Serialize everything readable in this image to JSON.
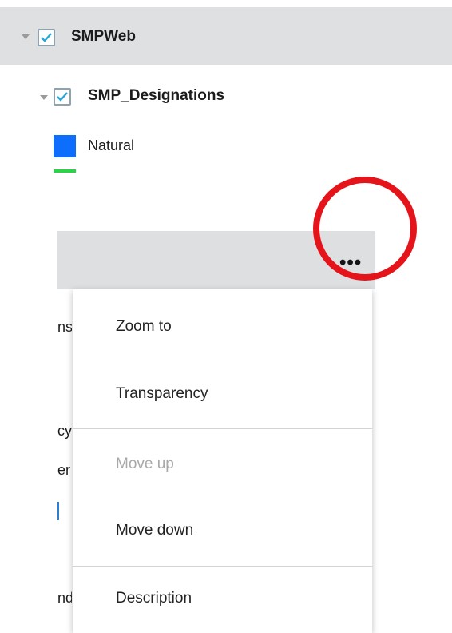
{
  "tree": {
    "root": {
      "label": "SMPWeb",
      "checked": true,
      "expanded": true
    },
    "child": {
      "label": "SMP_Designations",
      "checked": true,
      "expanded": true
    },
    "legend": [
      {
        "label": "Natural",
        "symbol": "fill",
        "color": "#0d6efd"
      },
      {
        "label": "",
        "symbol": "line",
        "color": "#2ed14a"
      }
    ]
  },
  "panel": {
    "more_options_label": "•••",
    "clipped_text": [
      "ns",
      "cy",
      "er",
      "nd"
    ]
  },
  "menu": {
    "items": [
      {
        "label": "Zoom to",
        "enabled": true
      },
      {
        "label": "Transparency",
        "enabled": true
      },
      {
        "label": "Move up",
        "enabled": false
      },
      {
        "label": "Move down",
        "enabled": true
      },
      {
        "label": "Description",
        "enabled": true
      }
    ]
  },
  "annotation": {
    "color": "#e5141b",
    "target": "more-options-button"
  }
}
